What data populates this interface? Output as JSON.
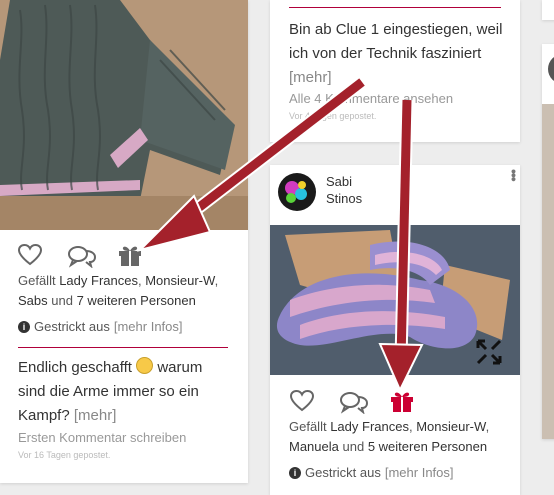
{
  "left_post": {
    "liked_by": {
      "prefix": "Gefällt",
      "name1": "Lady Frances",
      "sep1": ",",
      "name2": "Monsieur-W",
      "sep2": ",",
      "name3": "Sabs",
      "and": "und",
      "more": "7 weiteren Personen"
    },
    "info_label": "Gestrickt aus",
    "info_link": "[mehr Infos]",
    "caption": "Endlich geschafft",
    "caption_rest": "warum sind die Arme immer so ein Kampf?",
    "caption_more": "[mehr]",
    "comment_prompt": "Ersten Kommentar schreiben",
    "posted": "Vor 16 Tagen gepostet."
  },
  "top_post": {
    "caption": "Bin ab Clue 1 eingestiegen, weil ich von der Technik fasziniert",
    "caption_more": "[mehr]",
    "comments_link": "Alle 4 Kommentare ansehen",
    "posted": "Vor 4 Tagen gepostet."
  },
  "right_post": {
    "user_first": "Sabi",
    "user_last": "Stinos",
    "liked_by": {
      "prefix": "Gefällt",
      "name1": "Lady Frances",
      "sep1": ",",
      "name2": "Monsieur-W",
      "sep2": ",",
      "name3": "Manuela",
      "and": "und",
      "more": "5 weiteren Personen"
    },
    "info_label": "Gestrickt aus",
    "info_link": "[mehr Infos]"
  },
  "icons": {
    "like": "heart-icon",
    "comment": "comment-bubbles-icon",
    "gift": "gift-icon",
    "info": "info-icon",
    "expand": "expand-icon",
    "menu": "more-vertical-icon"
  },
  "colors": {
    "accent": "#b0003a",
    "gift_active": "#cc0033",
    "arrow": "#a4212b",
    "icon_gray": "#666666"
  }
}
